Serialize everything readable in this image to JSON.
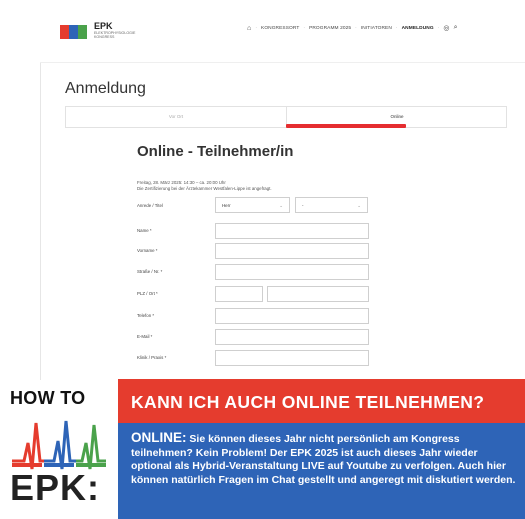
{
  "header": {
    "logo_title": "EPK",
    "logo_subtitle": "ELEKTROPHYSIOLOGIE KONGRESS",
    "nav": [
      "KONGRESSORT",
      "PROGRAMM 2025",
      "INITIATOREN",
      "ANMELDUNG"
    ],
    "active_nav": "ANMELDUNG"
  },
  "page": {
    "title": "Anmeldung",
    "tabs": [
      "Vor Ort",
      "Online"
    ],
    "form_title": "Online - Teilnehmer/in",
    "date_line": "Freitag, 28. März 2025: 14:30 – ca. 20:00 Uhr",
    "cert_line": "Die Zertifizierung bei der Ärztekammer Westfalen-Lippe ist angefragt.",
    "fields": {
      "anrede": "Anrede / Titel",
      "anrede_value": "Herr",
      "titel_value": "-",
      "name": "Name *",
      "vorname": "Vorname *",
      "strasse": "Straße / Nr. *",
      "plz": "PLZ / Ort *",
      "telefon": "Telefon *",
      "email": "E-Mail *",
      "klinik": "Klinik / Praxis *"
    }
  },
  "banner": {
    "howto": "HOW TO",
    "epk": "EPK:",
    "headline": "KANN ICH AUCH ONLINE TEILNEHMEN?",
    "lead": "ONLINE:",
    "body": " Sie können dieses Jahr nicht persönlich am Kongress teilnehmen? Kein Problem! Der EPK 2025 ist auch dieses Jahr wieder optional als Hybrid-Veranstaltung LIVE auf Youtube zu verfolgen. Auch hier können natürlich Fragen im Chat gestellt und angeregt mit diskutiert werden."
  },
  "colors": {
    "red": "#e53c2e",
    "blue": "#2e64b7",
    "green": "#4aa24b"
  }
}
